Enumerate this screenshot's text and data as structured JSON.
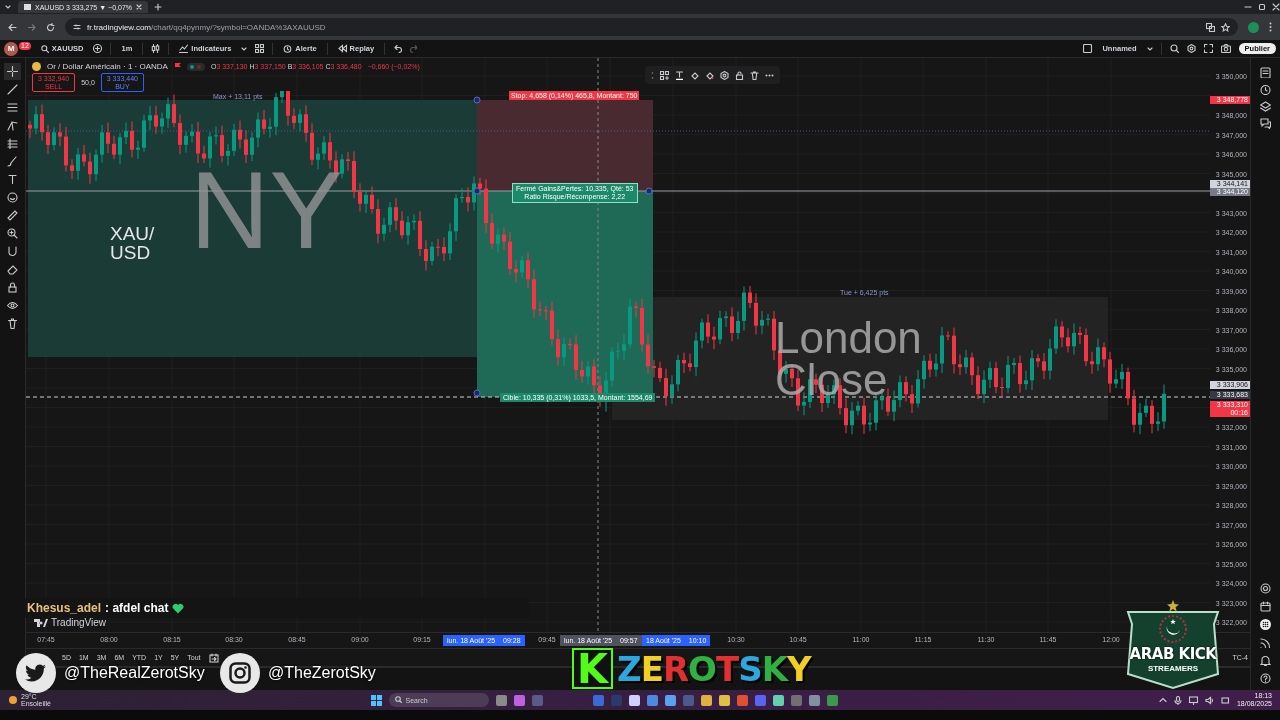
{
  "browser": {
    "tab_title": "XAUUSD 3 333,275 ▼ −0,07%",
    "url_host": "fr.tradingview.com",
    "url_path": "/chart/qq4pynmy/?symbol=OANDA%3AXAUUSD"
  },
  "toolbar": {
    "avatar": "M",
    "avatar_badge": "12",
    "symbol": "XAUUSD",
    "interval": "1m",
    "items": [
      {
        "kind": "indicators",
        "label": "Indicateurs"
      },
      {
        "kind": "alert",
        "label": "Alerte"
      },
      {
        "kind": "replay",
        "label": "Replay"
      }
    ],
    "layout_name": "Unnamed",
    "publish": "Publier"
  },
  "legend": {
    "title": "Or / Dollar Américain · 1 · OANDA",
    "ohlc": [
      {
        "key": "O",
        "value": "3 337,130"
      },
      {
        "key": "H",
        "value": "3 337,150"
      },
      {
        "key": "B",
        "value": "3 336,105"
      },
      {
        "key": "C",
        "value": "3 336,480"
      }
    ],
    "change": "−0,660 (−0,02%)",
    "sell": {
      "price": "3 332,940",
      "label": "SELL"
    },
    "spread": "50,0",
    "buy": {
      "price": "3 333,440",
      "label": "BUY"
    }
  },
  "annotations": [
    {
      "kind": "symbol-note",
      "lines": [
        "XAU/",
        "USD"
      ]
    },
    {
      "kind": "session-name",
      "lines": [
        "NY"
      ]
    },
    {
      "kind": "session-name",
      "lines": [
        "London",
        "Close"
      ]
    },
    {
      "kind": "range-label",
      "lines": [
        "Max + 13,11 pts"
      ]
    },
    {
      "kind": "stop-label",
      "lines": [
        "Stop: 4,658 (0,14%) 465,8, Montant: 750"
      ]
    },
    {
      "kind": "pnl-label",
      "lines": [
        "Fermé Gains&Pertes: 10,335, Qté: 53",
        "Ratio Risque/Récompense: 2,22"
      ]
    },
    {
      "kind": "target-label",
      "lines": [
        "Cible: 10,335 (0,31%) 1033,5, Montant: 1554,69"
      ]
    },
    {
      "kind": "range-label",
      "lines": [
        "Tue + 6,425 pts"
      ]
    }
  ],
  "price_axis": [
    "3 350,000",
    "3 348,000",
    "3 347,000",
    "3 346,000",
    "3 345,000",
    "3 343,000",
    "3 342,000",
    "3 341,000",
    "3 340,000",
    "3 339,000",
    "3 338,000",
    "3 337,000",
    "3 336,000",
    "3 335,000",
    "3 332,000",
    "3 331,000",
    "3 330,000",
    "3 329,000",
    "3 328,000",
    "3 327,000",
    "3 326,000",
    "3 325,000",
    "3 324,000",
    "3 323,000",
    "3 322,000"
  ],
  "price_badges": [
    {
      "lines": [
        "3 348,778"
      ],
      "color": "#f23645"
    },
    {
      "lines": [
        "3 344,141"
      ],
      "color": "#d1d4dc"
    },
    {
      "lines": [
        "3 344,120"
      ],
      "color": "#787b86"
    },
    {
      "lines": [
        "3 333,906"
      ],
      "color": "#d1d4dc"
    },
    {
      "lines": [
        "3 333,683"
      ],
      "color": "#363a45"
    },
    {
      "lines": [
        "3 333,310",
        "00:16"
      ],
      "color": "#f23645"
    }
  ],
  "time_axis": [
    "07:45",
    "08:00",
    "08:15",
    "08:30",
    "08:45",
    "09:00",
    "09:15",
    "09:45",
    "10:30",
    "10:45",
    "11:00",
    "11:15",
    "11:30",
    "11:45",
    "12:00"
  ],
  "time_badges": [
    {
      "date": "lun. 18 Août '25",
      "time": "09:28",
      "color": "#2962ff"
    },
    {
      "date": "lun. 18 Août '25",
      "time": "09:57",
      "color": "#50535e"
    },
    {
      "date": "18 Août '25",
      "time": "10:10",
      "color": "#2962ff"
    }
  ],
  "ranges": [
    "5D",
    "1M",
    "3M",
    "6M",
    "YTD",
    "1Y",
    "5Y",
    "Tout"
  ],
  "timezone": "TC-4",
  "stream": {
    "chat_user": "Khesus_adel",
    "chat_message": ": afdel chat",
    "brand": "TradingView",
    "twitter": "@TheRealZerotSky",
    "instagram": "@TheZerotSky",
    "logo_letter": "K",
    "logo_text": "ZEROTSKY",
    "badge_title": "ARAB KICK",
    "badge_subtitle": "STREAMERS"
  },
  "taskbar": {
    "temperature": "29°C",
    "weather": "Ensoleillé",
    "search_placeholder": "Search",
    "time": "18:13",
    "date": "18/08/2025"
  }
}
